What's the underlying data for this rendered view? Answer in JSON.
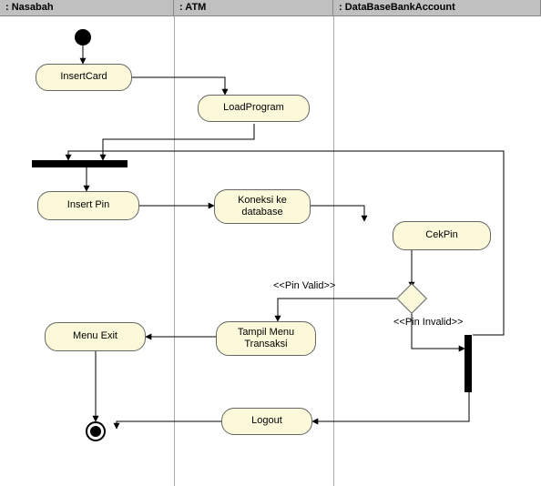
{
  "diagram_type": "UML Activity Diagram",
  "swimlanes": [
    {
      "label": ": Nasabah"
    },
    {
      "label": ": ATM"
    },
    {
      "label": ": DataBaseBankAccount"
    }
  ],
  "nodes": {
    "initial": {
      "kind": "initial"
    },
    "insertCard": {
      "label": "InsertCard",
      "lane": 0
    },
    "loadProgram": {
      "label": "LoadProgram",
      "lane": 1
    },
    "syncBar1": {
      "kind": "synchronization"
    },
    "insertPin": {
      "label": "Insert Pin",
      "lane": 0
    },
    "koneksi": {
      "label": "Koneksi ke\ndatabase",
      "lane": 1
    },
    "cekPin": {
      "label": "CekPin",
      "lane": 2
    },
    "decision": {
      "kind": "decision",
      "lane": 2
    },
    "tampilMenu": {
      "label": "Tampil Menu\nTransaksi",
      "lane": 1
    },
    "menuExit": {
      "label": "Menu Exit",
      "lane": 0
    },
    "syncBar2": {
      "kind": "synchronization"
    },
    "logout": {
      "label": "Logout",
      "lane": 1
    },
    "final": {
      "kind": "final"
    }
  },
  "guards": {
    "pinValid": "<<Pin Valid>>",
    "pinInvalid": "<<Pin Invalid>>"
  },
  "edges": [
    {
      "from": "initial",
      "to": "insertCard"
    },
    {
      "from": "insertCard",
      "to": "loadProgram"
    },
    {
      "from": "loadProgram",
      "to": "syncBar1"
    },
    {
      "from": "syncBar1",
      "to": "insertPin"
    },
    {
      "from": "insertPin",
      "to": "koneksi"
    },
    {
      "from": "koneksi",
      "to": "cekPin"
    },
    {
      "from": "cekPin",
      "to": "decision"
    },
    {
      "from": "decision",
      "to": "tampilMenu",
      "guard": "pinValid"
    },
    {
      "from": "decision",
      "to": "syncBar2",
      "guard": "pinInvalid"
    },
    {
      "from": "tampilMenu",
      "to": "menuExit"
    },
    {
      "from": "menuExit",
      "to": "final"
    },
    {
      "from": "syncBar2",
      "to": "syncBar1"
    },
    {
      "from": "syncBar2",
      "to": "logout"
    },
    {
      "from": "logout",
      "to": "final"
    }
  ]
}
